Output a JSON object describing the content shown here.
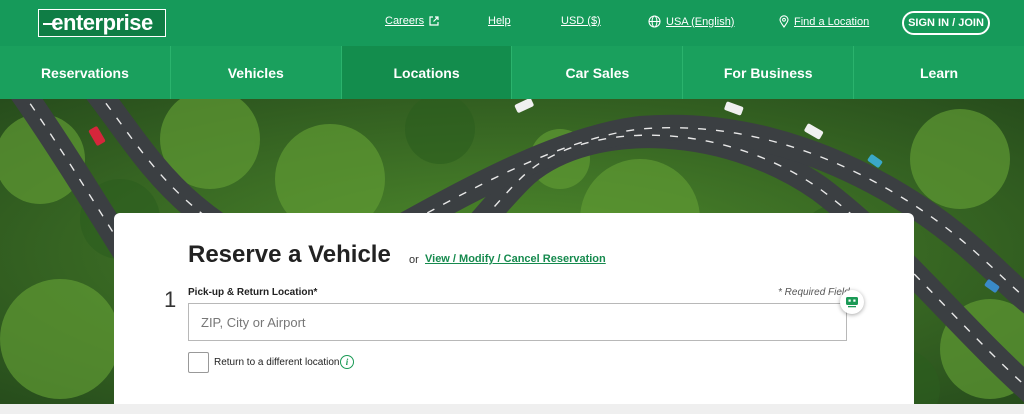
{
  "brand": {
    "logo_text": "enterprise"
  },
  "topbar": {
    "careers": "Careers",
    "help": "Help",
    "currency": "USD ($)",
    "region": "USA (English)",
    "find_location": "Find a Location",
    "signin": "SIGN IN / JOIN"
  },
  "nav": {
    "items": [
      "Reservations",
      "Vehicles",
      "Locations",
      "Car Sales",
      "For Business",
      "Learn"
    ],
    "active": "Locations"
  },
  "reserve": {
    "title": "Reserve a Vehicle",
    "or": "or",
    "modify_link": "View / Modify / Cancel Reservation",
    "step": "1",
    "field_label": "Pick-up & Return Location*",
    "required_note": "* Required Field",
    "placeholder": "ZIP, City or Airport",
    "return_label": "Return to a different location"
  },
  "colors": {
    "brand_green": "#169a5a",
    "nav_green": "#1aa05d",
    "link_green": "#168a4e"
  },
  "icons": [
    "external-link-icon",
    "globe-icon",
    "location-pin-icon",
    "info-icon",
    "chat-icon"
  ]
}
